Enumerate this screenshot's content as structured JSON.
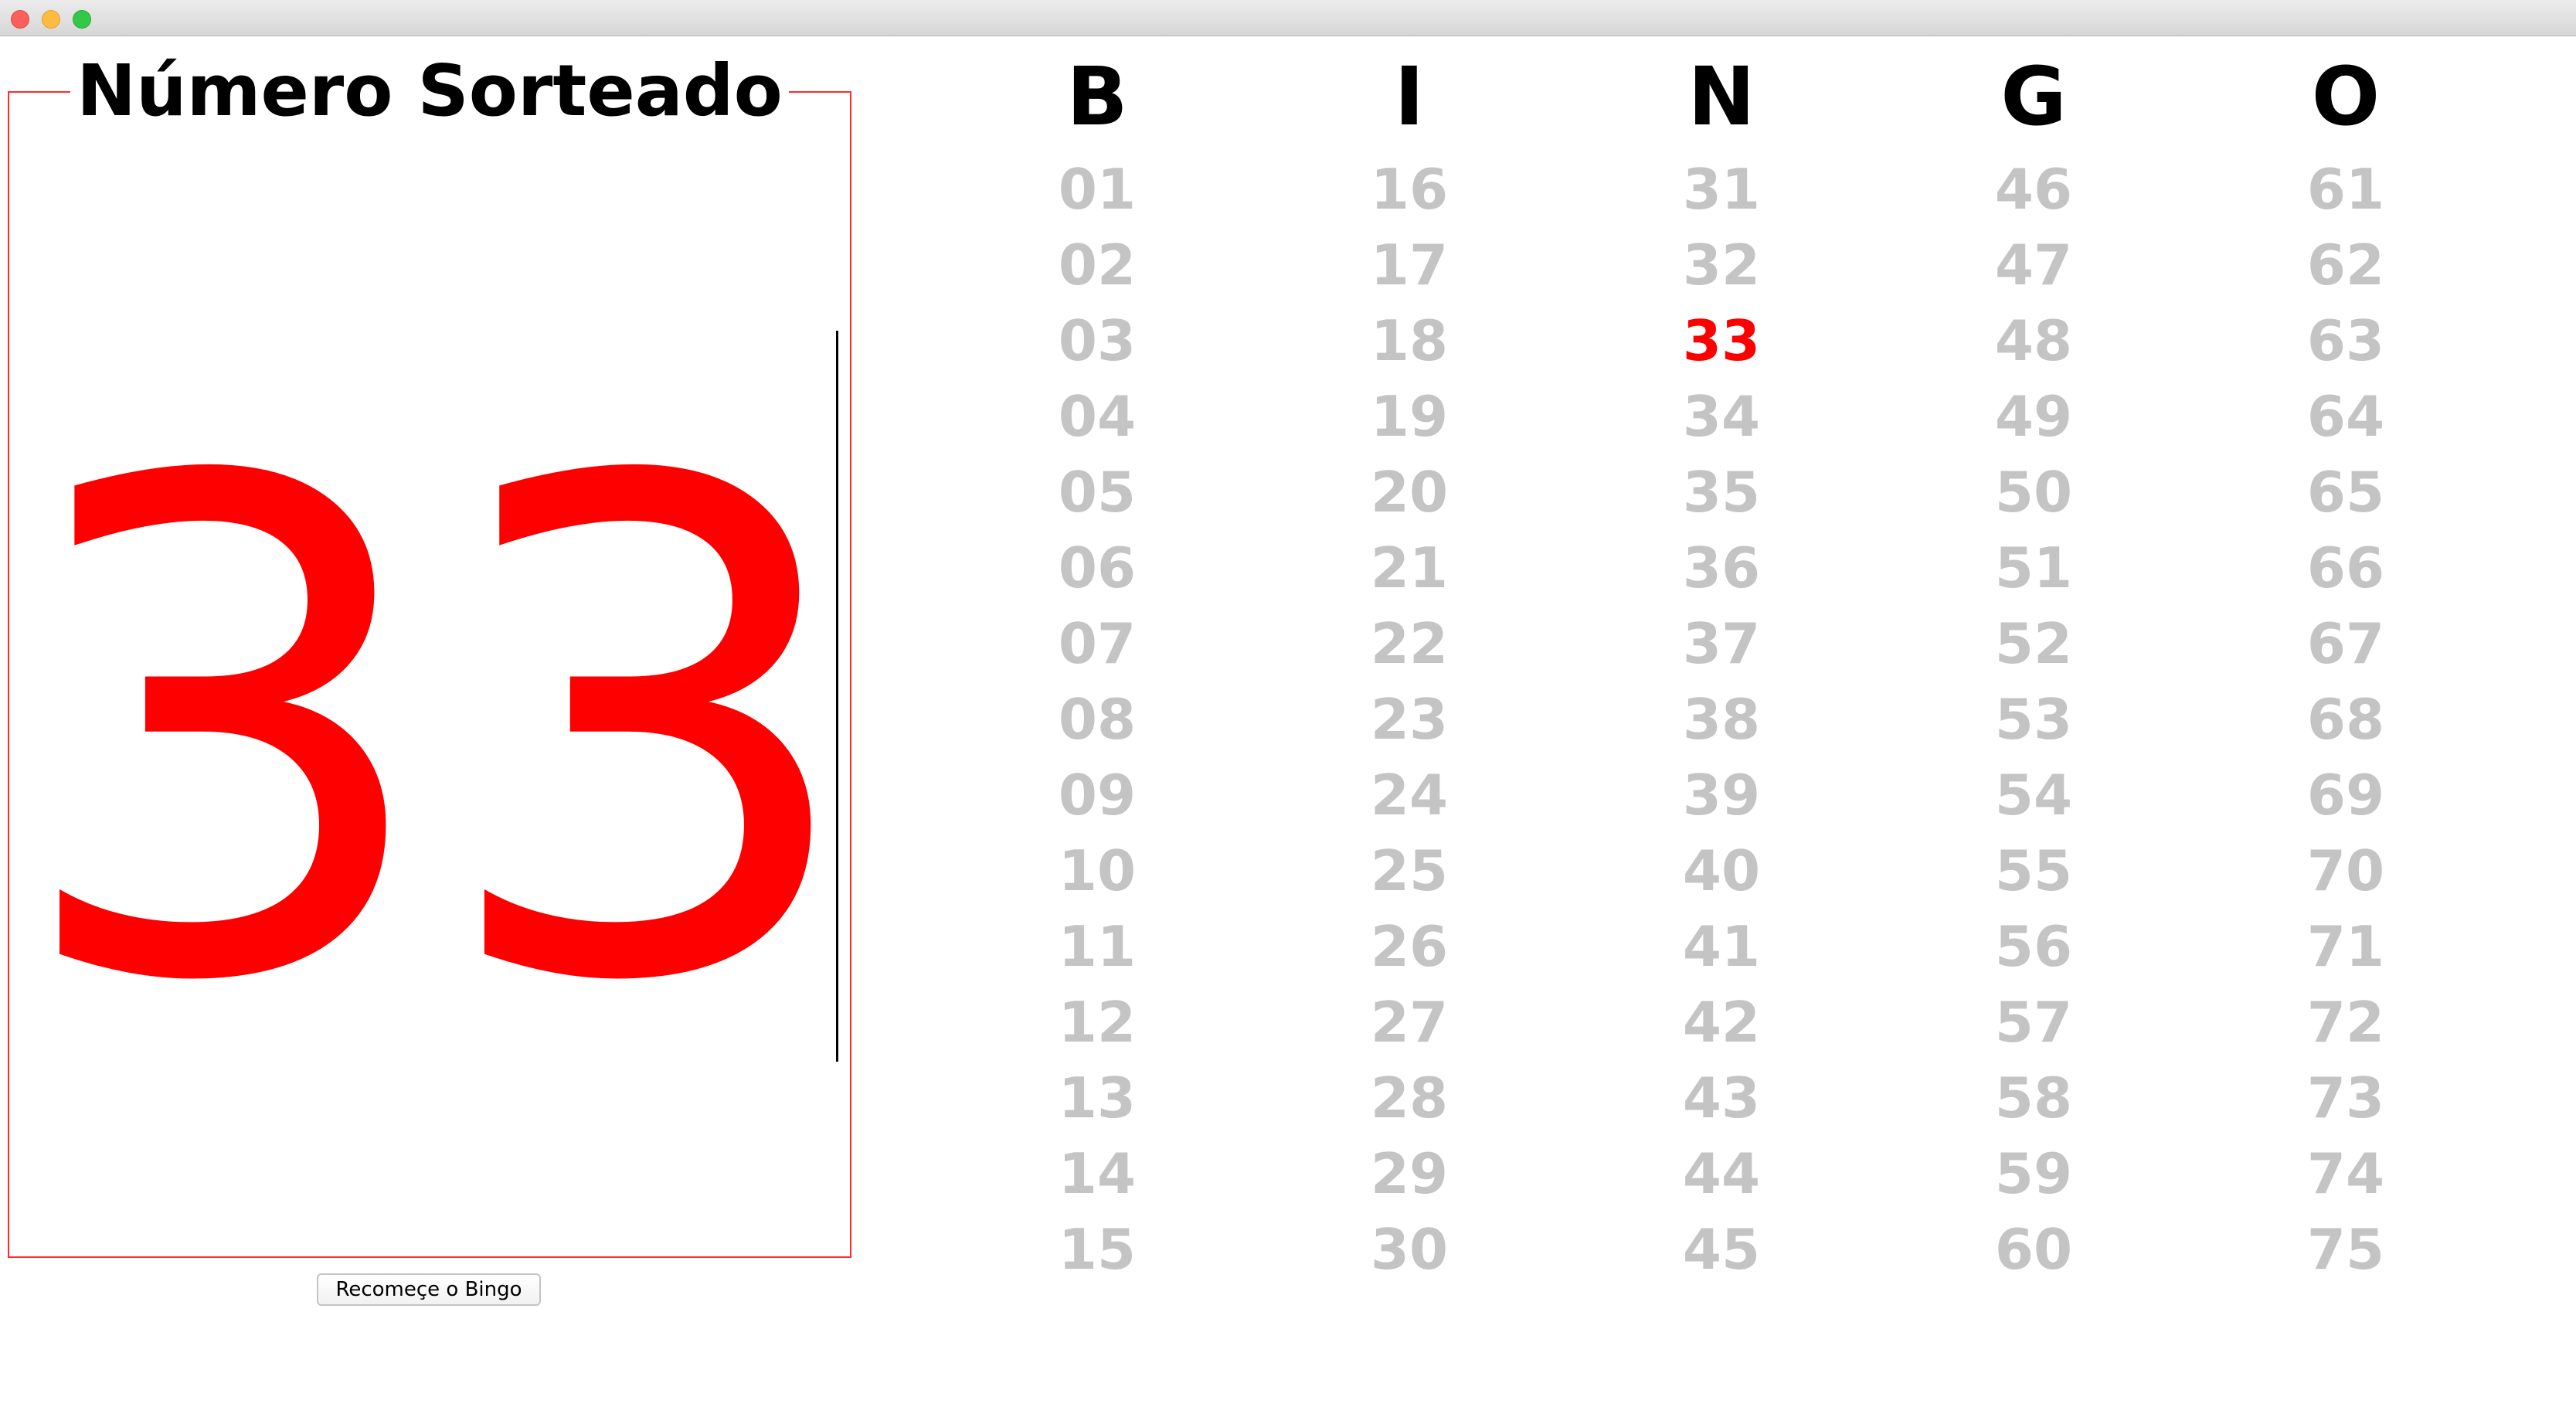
{
  "window": {
    "controls": [
      "close",
      "minimize",
      "maximize"
    ]
  },
  "drawn_panel": {
    "title": "Número Sorteado",
    "number": "33",
    "number_color": "#ff0000",
    "border_color": "#ff2a2a"
  },
  "restart_button": {
    "label": "Recomeçe o Bingo"
  },
  "board": {
    "drawn_color": "#ff0000",
    "undrawn_color": "#c4c4c4",
    "columns": [
      {
        "letter": "B",
        "numbers": [
          "01",
          "02",
          "03",
          "04",
          "05",
          "06",
          "07",
          "08",
          "09",
          "10",
          "11",
          "12",
          "13",
          "14",
          "15"
        ]
      },
      {
        "letter": "I",
        "numbers": [
          "16",
          "17",
          "18",
          "19",
          "20",
          "21",
          "22",
          "23",
          "24",
          "25",
          "26",
          "27",
          "28",
          "29",
          "30"
        ]
      },
      {
        "letter": "N",
        "numbers": [
          "31",
          "32",
          "33",
          "34",
          "35",
          "36",
          "37",
          "38",
          "39",
          "40",
          "41",
          "42",
          "43",
          "44",
          "45"
        ]
      },
      {
        "letter": "G",
        "numbers": [
          "46",
          "47",
          "48",
          "49",
          "50",
          "51",
          "52",
          "53",
          "54",
          "55",
          "56",
          "57",
          "58",
          "59",
          "60"
        ]
      },
      {
        "letter": "O",
        "numbers": [
          "61",
          "62",
          "63",
          "64",
          "65",
          "66",
          "67",
          "68",
          "69",
          "70",
          "71",
          "72",
          "73",
          "74",
          "75"
        ]
      }
    ],
    "drawn_numbers": [
      "33"
    ]
  }
}
